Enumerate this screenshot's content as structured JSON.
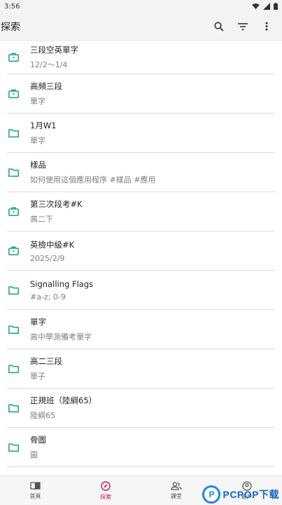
{
  "status": {
    "time": "3:56"
  },
  "app_bar": {
    "title": "探索"
  },
  "colors": {
    "accent": "#1a9f8f",
    "nav_active": "#c2185b"
  },
  "items": [
    {
      "icon": "briefcase-icon",
      "title": "三段空英單字",
      "subtitle": "12/2〜1/4"
    },
    {
      "icon": "briefcase-icon",
      "title": "高頻三段",
      "subtitle": "單字"
    },
    {
      "icon": "folder-icon",
      "title": "1月W1",
      "subtitle": "單字"
    },
    {
      "icon": "folder-icon",
      "title": "樣品",
      "subtitle": "如何使用這個應用程序 #樣品 #應用"
    },
    {
      "icon": "briefcase-icon",
      "title": "第三次段考#K",
      "subtitle": "高二下"
    },
    {
      "icon": "briefcase-icon",
      "title": "英檢中級#K",
      "subtitle": "2025/2/9"
    },
    {
      "icon": "folder-icon",
      "title": "Signalling Flags",
      "subtitle": "#a-z; 0-9"
    },
    {
      "icon": "folder-icon",
      "title": "單字",
      "subtitle": "高中學測備考單字"
    },
    {
      "icon": "folder-icon",
      "title": "高二三段",
      "subtitle": "單子"
    },
    {
      "icon": "folder-icon",
      "title": "正規班（陸綱65）",
      "subtitle": "陸綱65"
    },
    {
      "icon": "folder-icon",
      "title": "骨圖",
      "subtitle": "圖"
    }
  ],
  "nav": [
    {
      "icon": "book-icon",
      "label": "首頁"
    },
    {
      "icon": "compass-icon",
      "label": "探索"
    },
    {
      "icon": "people-icon",
      "label": "課堂"
    },
    {
      "icon": "account-icon",
      "label": "帳戶"
    }
  ],
  "watermark": {
    "badge": "P",
    "text": "PCPOP下载"
  }
}
